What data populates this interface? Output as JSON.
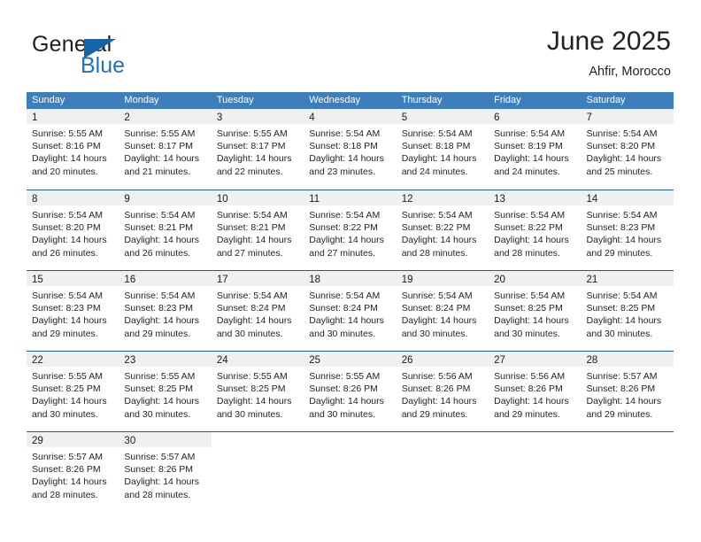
{
  "brand": {
    "name_part1": "General",
    "name_part2": "Blue",
    "logo_icon": "triangle-logo-icon",
    "accent_color": "#1565ad"
  },
  "header": {
    "title": "June 2025",
    "subtitle": "Ahfir, Morocco"
  },
  "colors": {
    "header_band": "#3d7ebd",
    "row_divider": "#1f5fa0",
    "daynum_band": "#f0f0f0",
    "brand_blue": "#1f72bd"
  },
  "weekday_headers": [
    "Sunday",
    "Monday",
    "Tuesday",
    "Wednesday",
    "Thursday",
    "Friday",
    "Saturday"
  ],
  "weeks": [
    [
      {
        "day": "1",
        "sunrise": "Sunrise: 5:55 AM",
        "sunset": "Sunset: 8:16 PM",
        "daylight1": "Daylight: 14 hours",
        "daylight2": "and 20 minutes."
      },
      {
        "day": "2",
        "sunrise": "Sunrise: 5:55 AM",
        "sunset": "Sunset: 8:17 PM",
        "daylight1": "Daylight: 14 hours",
        "daylight2": "and 21 minutes."
      },
      {
        "day": "3",
        "sunrise": "Sunrise: 5:55 AM",
        "sunset": "Sunset: 8:17 PM",
        "daylight1": "Daylight: 14 hours",
        "daylight2": "and 22 minutes."
      },
      {
        "day": "4",
        "sunrise": "Sunrise: 5:54 AM",
        "sunset": "Sunset: 8:18 PM",
        "daylight1": "Daylight: 14 hours",
        "daylight2": "and 23 minutes."
      },
      {
        "day": "5",
        "sunrise": "Sunrise: 5:54 AM",
        "sunset": "Sunset: 8:18 PM",
        "daylight1": "Daylight: 14 hours",
        "daylight2": "and 24 minutes."
      },
      {
        "day": "6",
        "sunrise": "Sunrise: 5:54 AM",
        "sunset": "Sunset: 8:19 PM",
        "daylight1": "Daylight: 14 hours",
        "daylight2": "and 24 minutes."
      },
      {
        "day": "7",
        "sunrise": "Sunrise: 5:54 AM",
        "sunset": "Sunset: 8:20 PM",
        "daylight1": "Daylight: 14 hours",
        "daylight2": "and 25 minutes."
      }
    ],
    [
      {
        "day": "8",
        "sunrise": "Sunrise: 5:54 AM",
        "sunset": "Sunset: 8:20 PM",
        "daylight1": "Daylight: 14 hours",
        "daylight2": "and 26 minutes."
      },
      {
        "day": "9",
        "sunrise": "Sunrise: 5:54 AM",
        "sunset": "Sunset: 8:21 PM",
        "daylight1": "Daylight: 14 hours",
        "daylight2": "and 26 minutes."
      },
      {
        "day": "10",
        "sunrise": "Sunrise: 5:54 AM",
        "sunset": "Sunset: 8:21 PM",
        "daylight1": "Daylight: 14 hours",
        "daylight2": "and 27 minutes."
      },
      {
        "day": "11",
        "sunrise": "Sunrise: 5:54 AM",
        "sunset": "Sunset: 8:22 PM",
        "daylight1": "Daylight: 14 hours",
        "daylight2": "and 27 minutes."
      },
      {
        "day": "12",
        "sunrise": "Sunrise: 5:54 AM",
        "sunset": "Sunset: 8:22 PM",
        "daylight1": "Daylight: 14 hours",
        "daylight2": "and 28 minutes."
      },
      {
        "day": "13",
        "sunrise": "Sunrise: 5:54 AM",
        "sunset": "Sunset: 8:22 PM",
        "daylight1": "Daylight: 14 hours",
        "daylight2": "and 28 minutes."
      },
      {
        "day": "14",
        "sunrise": "Sunrise: 5:54 AM",
        "sunset": "Sunset: 8:23 PM",
        "daylight1": "Daylight: 14 hours",
        "daylight2": "and 29 minutes."
      }
    ],
    [
      {
        "day": "15",
        "sunrise": "Sunrise: 5:54 AM",
        "sunset": "Sunset: 8:23 PM",
        "daylight1": "Daylight: 14 hours",
        "daylight2": "and 29 minutes."
      },
      {
        "day": "16",
        "sunrise": "Sunrise: 5:54 AM",
        "sunset": "Sunset: 8:23 PM",
        "daylight1": "Daylight: 14 hours",
        "daylight2": "and 29 minutes."
      },
      {
        "day": "17",
        "sunrise": "Sunrise: 5:54 AM",
        "sunset": "Sunset: 8:24 PM",
        "daylight1": "Daylight: 14 hours",
        "daylight2": "and 30 minutes."
      },
      {
        "day": "18",
        "sunrise": "Sunrise: 5:54 AM",
        "sunset": "Sunset: 8:24 PM",
        "daylight1": "Daylight: 14 hours",
        "daylight2": "and 30 minutes."
      },
      {
        "day": "19",
        "sunrise": "Sunrise: 5:54 AM",
        "sunset": "Sunset: 8:24 PM",
        "daylight1": "Daylight: 14 hours",
        "daylight2": "and 30 minutes."
      },
      {
        "day": "20",
        "sunrise": "Sunrise: 5:54 AM",
        "sunset": "Sunset: 8:25 PM",
        "daylight1": "Daylight: 14 hours",
        "daylight2": "and 30 minutes."
      },
      {
        "day": "21",
        "sunrise": "Sunrise: 5:54 AM",
        "sunset": "Sunset: 8:25 PM",
        "daylight1": "Daylight: 14 hours",
        "daylight2": "and 30 minutes."
      }
    ],
    [
      {
        "day": "22",
        "sunrise": "Sunrise: 5:55 AM",
        "sunset": "Sunset: 8:25 PM",
        "daylight1": "Daylight: 14 hours",
        "daylight2": "and 30 minutes."
      },
      {
        "day": "23",
        "sunrise": "Sunrise: 5:55 AM",
        "sunset": "Sunset: 8:25 PM",
        "daylight1": "Daylight: 14 hours",
        "daylight2": "and 30 minutes."
      },
      {
        "day": "24",
        "sunrise": "Sunrise: 5:55 AM",
        "sunset": "Sunset: 8:25 PM",
        "daylight1": "Daylight: 14 hours",
        "daylight2": "and 30 minutes."
      },
      {
        "day": "25",
        "sunrise": "Sunrise: 5:55 AM",
        "sunset": "Sunset: 8:26 PM",
        "daylight1": "Daylight: 14 hours",
        "daylight2": "and 30 minutes."
      },
      {
        "day": "26",
        "sunrise": "Sunrise: 5:56 AM",
        "sunset": "Sunset: 8:26 PM",
        "daylight1": "Daylight: 14 hours",
        "daylight2": "and 29 minutes."
      },
      {
        "day": "27",
        "sunrise": "Sunrise: 5:56 AM",
        "sunset": "Sunset: 8:26 PM",
        "daylight1": "Daylight: 14 hours",
        "daylight2": "and 29 minutes."
      },
      {
        "day": "28",
        "sunrise": "Sunrise: 5:57 AM",
        "sunset": "Sunset: 8:26 PM",
        "daylight1": "Daylight: 14 hours",
        "daylight2": "and 29 minutes."
      }
    ],
    [
      {
        "day": "29",
        "sunrise": "Sunrise: 5:57 AM",
        "sunset": "Sunset: 8:26 PM",
        "daylight1": "Daylight: 14 hours",
        "daylight2": "and 28 minutes."
      },
      {
        "day": "30",
        "sunrise": "Sunrise: 5:57 AM",
        "sunset": "Sunset: 8:26 PM",
        "daylight1": "Daylight: 14 hours",
        "daylight2": "and 28 minutes."
      },
      {
        "day": "",
        "sunrise": "",
        "sunset": "",
        "daylight1": "",
        "daylight2": ""
      },
      {
        "day": "",
        "sunrise": "",
        "sunset": "",
        "daylight1": "",
        "daylight2": ""
      },
      {
        "day": "",
        "sunrise": "",
        "sunset": "",
        "daylight1": "",
        "daylight2": ""
      },
      {
        "day": "",
        "sunrise": "",
        "sunset": "",
        "daylight1": "",
        "daylight2": ""
      },
      {
        "day": "",
        "sunrise": "",
        "sunset": "",
        "daylight1": "",
        "daylight2": ""
      }
    ]
  ]
}
